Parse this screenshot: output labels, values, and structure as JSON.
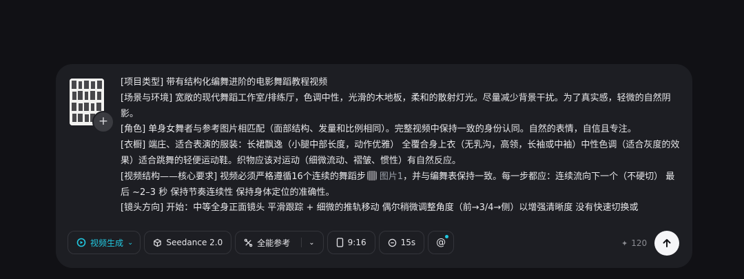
{
  "prompt": {
    "lines": [
      "[项目类型] 带有结构化编舞进阶的电影舞蹈教程视频",
      "[场景与环境] 宽敞的现代舞蹈工作室/排练厅，色调中性，光滑的木地板，柔和的散射灯光。尽量减少背景干扰。为了真实感，轻微的自然阴影。",
      "[角色] 单身女舞者与参考图片相匹配（面部结构、发量和比例相同）。完整视频中保持一致的身份认同。自然的表情，自信且专注。",
      "[衣橱] 端庄、适合表演的服装：长裙飘逸（小腿中部长度，动作优雅） 全覆合身上衣（无乳沟，高领，长袖或中袖）中性色调（适合灰度的效果）适合跳舞的轻便运动鞋。织物应该对运动（细微流动、褶皱、惯性）有自然反应。",
      "[镜头方向] 开始：中等全身正面镜头 平滑跟踪 + 细微的推轨移动 偶尔稍微调整角度（前→3/4→侧）以增强清晰度 没有快速切换或"
    ],
    "structure_before": "[视频结构——核心要求] 视频必须严格遵循16个连续的舞蹈步",
    "image_ref": "图片1",
    "structure_after": "，并与编舞表保持一致。每一步都应：连续流向下一个（不硬切） 最后 ~2–3 秒 保持节奏连续性 保持身体定位的准确性。"
  },
  "toolbar": {
    "mode_label": "视频生成",
    "model_label": "Seedance 2.0",
    "reference_label": "全能参考",
    "ratio_label": "9:16",
    "duration_label": "15s",
    "mention_label": "@"
  },
  "credits": "120",
  "icons": {
    "mode": "video-generate-icon",
    "model": "cube-icon",
    "reference": "sparkle-reference-icon",
    "ratio": "phone-portrait-icon",
    "duration": "clock-icon",
    "mention": "at-icon",
    "credits": "sparkle-icon",
    "send": "arrow-up-icon",
    "add": "plus-icon"
  },
  "colors": {
    "accent": "#22c8e0",
    "background": "#111115",
    "card": "#1d1e23"
  }
}
